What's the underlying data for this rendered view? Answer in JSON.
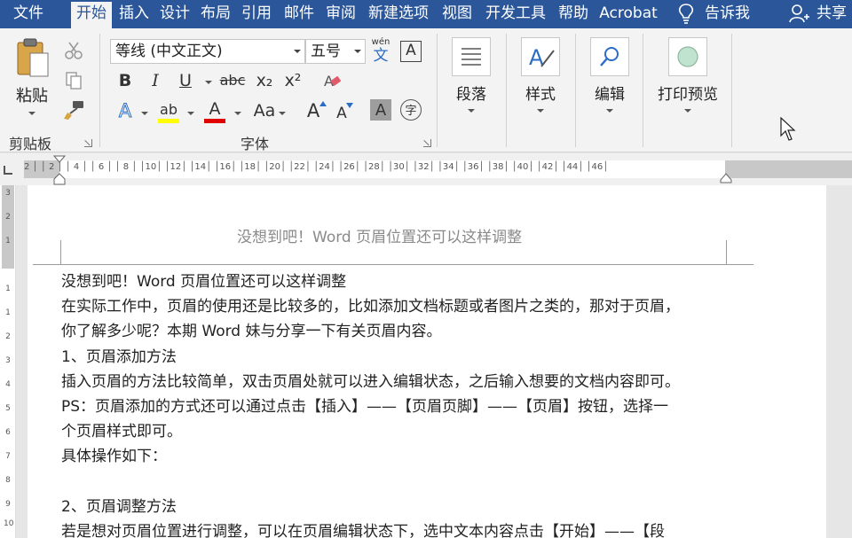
{
  "tabs": [
    {
      "label": "文件",
      "active": false
    },
    {
      "label": "开始",
      "active": true
    },
    {
      "label": "插入",
      "active": false
    },
    {
      "label": "设计",
      "active": false
    },
    {
      "label": "布局",
      "active": false
    },
    {
      "label": "引用",
      "active": false
    },
    {
      "label": "邮件",
      "active": false
    },
    {
      "label": "审阅",
      "active": false
    },
    {
      "label": "新建选项",
      "active": false
    },
    {
      "label": "视图",
      "active": false
    },
    {
      "label": "开发工具",
      "active": false
    },
    {
      "label": "帮助",
      "active": false
    },
    {
      "label": "Acrobat",
      "active": false
    }
  ],
  "tell_me": "告诉我",
  "share": "共享",
  "clipboard": {
    "paste_label": "粘贴",
    "group_label": "剪贴板"
  },
  "font": {
    "font_name": "等线 (中文正文)",
    "font_size": "五号",
    "phonetic_top": "wén",
    "phonetic_bottom": "文",
    "border_char": "A",
    "bold": "B",
    "italic": "I",
    "underline": "U",
    "strike": "abc",
    "subscript": "x₂",
    "superscript": "x²",
    "text_effect": "A",
    "highlight": "ab",
    "font_color": "A",
    "change_case": "Aa",
    "grow": "A",
    "shrink": "A",
    "shading": "A",
    "enclose": "字",
    "group_label": "字体"
  },
  "paragraph": {
    "label": "段落"
  },
  "styles": {
    "label": "样式"
  },
  "editing": {
    "label": "编辑"
  },
  "print_preview": {
    "label": "打印预览"
  },
  "ruler": {
    "h_ticks": "2 │ │ 2 │ │ 4 │ │ 6 │ │ 8 │ │10│ │12│ │14│ │16│ │18│ │20│ │22│ │24│ │26│ │28│ │30│ │32│ │34│ │36│ │38│ │40│ │42│ │44│ │46│",
    "v_ticks": [
      "3",
      "2",
      "1",
      "1",
      "1",
      "2",
      "3",
      "4",
      "5",
      "6",
      "7",
      "8",
      "9",
      "10"
    ]
  },
  "document": {
    "header_text": "没想到吧！Word 页眉位置还可以这样调整",
    "lines": [
      "没想到吧！Word 页眉位置还可以这样调整",
      "在实际工作中，页眉的使用还是比较多的，比如添加文档标题或者图片之类的，那对于页眉，",
      "你了解多少呢？本期 Word 妹与分享一下有关页眉内容。",
      "1、页眉添加方法",
      "插入页眉的方法比较简单，双击页眉处就可以进入编辑状态，之后输入想要的文档内容即可。",
      "PS：页眉添加的方式还可以通过点击【插入】——【页眉页脚】——【页眉】按钮，选择一",
      "个页眉样式即可。",
      "具体操作如下：",
      "",
      "2、页眉调整方法",
      "若是想对页眉位置进行调整，可以在页眉编辑状态下，选中文本内容点击【开始】——【段"
    ]
  },
  "colors": {
    "accent": "#2b579a",
    "highlight": "#ffff00",
    "font_color": "#e00000",
    "ribbon_bg": "#f3f3f3"
  }
}
